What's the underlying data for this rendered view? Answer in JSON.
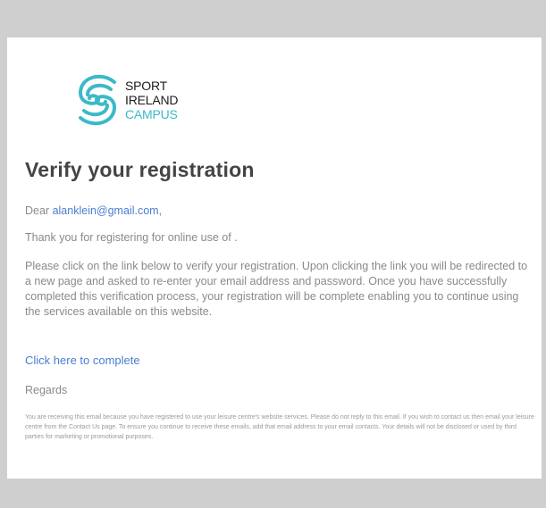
{
  "brand": {
    "logo_line_1": "SPORT",
    "logo_line_2": "IRELAND",
    "logo_line_3": "CAMPUS",
    "colors": {
      "teal": "#3cb9c8",
      "link": "#4a7fd0",
      "heading": "#444444",
      "body_text": "#8a8a8a"
    }
  },
  "email": {
    "heading": "Verify your registration",
    "greeting_prefix": "Dear ",
    "recipient_email": "alanklein@gmail.com",
    "greeting_suffix": ",",
    "thanks_text": "Thank you for registering for online use of .",
    "instructions": "Please click on the link below to verify your registration. Upon clicking the link you will be redirected to a new page and asked to re-enter your email address and password. Once you have successfully completed this verification process, your registration will be complete enabling you to continue using the services available on this website.",
    "cta_label": "Click here to complete",
    "regards": "Regards",
    "footer_note": "You are receiving this email because you have registered to use your leisure centre's website services. Please do not reply to this email. If you wish to contact us then email your leisure centre from the Contact Us page. To ensure you continue to receive these emails, add that email address to your email contacts. Your details will not be disclosed or used by third parties for marketing or promotional purposes."
  }
}
